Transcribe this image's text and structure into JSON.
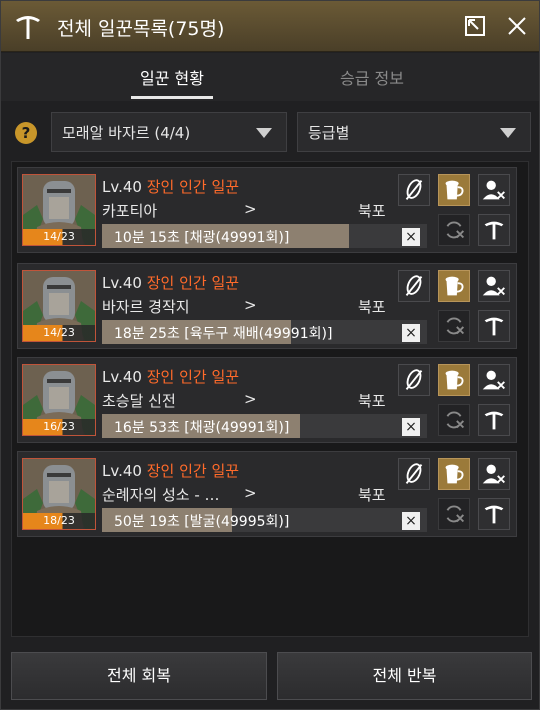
{
  "window": {
    "title": "전체 일꾼목록(75명)"
  },
  "tabs": [
    {
      "label": "일꾼 현황",
      "active": true
    },
    {
      "label": "승급 정보",
      "active": false
    }
  ],
  "filters": {
    "help": "?",
    "town": "모래알 바자르 (4/4)",
    "sort": "등급별"
  },
  "workers": [
    {
      "level": "Lv.40",
      "grade": "장인 인간 일꾼",
      "location": "카포티아",
      "arrow": ">",
      "destination": "북포",
      "stamina": "14/23",
      "task": "10분 15초 [채광(49991회)]",
      "progress": 0.76
    },
    {
      "level": "Lv.40",
      "grade": "장인 인간 일꾼",
      "location": "바자르 경작지",
      "arrow": ">",
      "destination": "북포",
      "stamina": "14/23",
      "task": "18분 25초 [육두구 재배(49991회)]",
      "progress": 0.58
    },
    {
      "level": "Lv.40",
      "grade": "장인 인간 일꾼",
      "location": "초승달 신전",
      "arrow": ">",
      "destination": "북포",
      "stamina": "16/23",
      "task": "16분 53초 [채광(49991회)]",
      "progress": 0.61
    },
    {
      "level": "Lv.40",
      "grade": "장인 인간 일꾼",
      "location": "순례자의 성소 - …",
      "arrow": ">",
      "destination": "북포",
      "stamina": "18/23",
      "task": "50분 19초 [발굴(49995회)]",
      "progress": 0.4
    }
  ],
  "bar_close": "×",
  "footer": {
    "recover_all": "전체 회복",
    "repeat_all": "전체 반복"
  },
  "colors": {
    "title_bar": "#5a4a2e",
    "grade_text": "#ff6a2a",
    "stamina_fill": "#e6861b",
    "gold_button": "#9b7a3a"
  }
}
